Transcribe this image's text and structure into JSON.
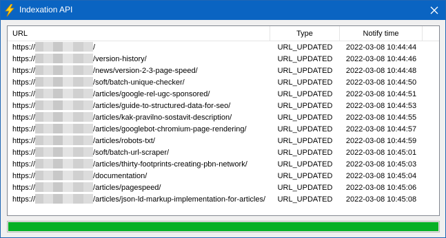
{
  "window": {
    "title": "Indexation API",
    "icon": "lightning-bolt-icon",
    "close_icon": "close-icon"
  },
  "table": {
    "columns": [
      "URL",
      "Type",
      "Notify time"
    ],
    "rows": [
      {
        "url_prefix": "https://",
        "url_path": "/",
        "type": "URL_UPDATED",
        "time": "2022-03-08 10:44:44"
      },
      {
        "url_prefix": "https://",
        "url_path": "/version-history/",
        "type": "URL_UPDATED",
        "time": "2022-03-08 10:44:46"
      },
      {
        "url_prefix": "https://",
        "url_path": "/news/version-2-3-page-speed/",
        "type": "URL_UPDATED",
        "time": "2022-03-08 10:44:48"
      },
      {
        "url_prefix": "https://",
        "url_path": "/soft/batch-unique-checker/",
        "type": "URL_UPDATED",
        "time": "2022-03-08 10:44:50"
      },
      {
        "url_prefix": "https://",
        "url_path": "/articles/google-rel-ugc-sponsored/",
        "type": "URL_UPDATED",
        "time": "2022-03-08 10:44:51"
      },
      {
        "url_prefix": "https://",
        "url_path": "/articles/guide-to-structured-data-for-seo/",
        "type": "URL_UPDATED",
        "time": "2022-03-08 10:44:53"
      },
      {
        "url_prefix": "https://",
        "url_path": "/articles/kak-pravilno-sostavit-description/",
        "type": "URL_UPDATED",
        "time": "2022-03-08 10:44:55"
      },
      {
        "url_prefix": "https://",
        "url_path": "/articles/googlebot-chromium-page-rendering/",
        "type": "URL_UPDATED",
        "time": "2022-03-08 10:44:57"
      },
      {
        "url_prefix": "https://",
        "url_path": "/articles/robots-txt/",
        "type": "URL_UPDATED",
        "time": "2022-03-08 10:44:59"
      },
      {
        "url_prefix": "https://",
        "url_path": "/soft/batch-url-scraper/",
        "type": "URL_UPDATED",
        "time": "2022-03-08 10:45:01"
      },
      {
        "url_prefix": "https://",
        "url_path": "/articles/thirty-footprints-creating-pbn-network/",
        "type": "URL_UPDATED",
        "time": "2022-03-08 10:45:03"
      },
      {
        "url_prefix": "https://",
        "url_path": "/documentation/",
        "type": "URL_UPDATED",
        "time": "2022-03-08 10:45:04"
      },
      {
        "url_prefix": "https://",
        "url_path": "/articles/pagespeed/",
        "type": "URL_UPDATED",
        "time": "2022-03-08 10:45:06"
      },
      {
        "url_prefix": "https://",
        "url_path": "/articles/json-ld-markup-implementation-for-articles/",
        "type": "URL_UPDATED",
        "time": "2022-03-08 10:45:08"
      }
    ]
  },
  "progress": {
    "fraction": 1.0,
    "color": "#06b025"
  },
  "colors": {
    "titlebar": "#0a64c2",
    "title_text": "#ffffff"
  }
}
